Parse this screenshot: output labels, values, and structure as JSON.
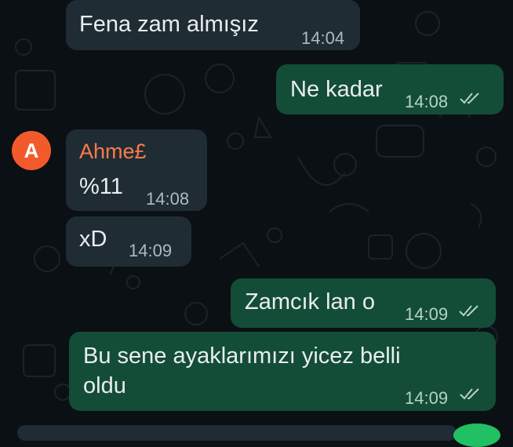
{
  "chat": {
    "messages": [
      {
        "direction": "incoming",
        "text": "Fena zam almışız",
        "time": "14:04"
      },
      {
        "direction": "outgoing",
        "text": "Ne kadar",
        "time": "14:08",
        "status": "read"
      },
      {
        "direction": "incoming",
        "sender": "Ahme£",
        "avatar_initial": "A",
        "text": "%11",
        "time": "14:08"
      },
      {
        "direction": "incoming",
        "text": "xD",
        "time": "14:09"
      },
      {
        "direction": "outgoing",
        "text": "Zamcık lan o",
        "time": "14:09",
        "status": "read"
      },
      {
        "direction": "outgoing",
        "text_line1": "Bu sene ayaklarımızı yicez belli",
        "text_line2": "oldu",
        "time": "14:09",
        "status": "read"
      }
    ]
  },
  "colors": {
    "background": "#0b1014",
    "incoming_bubble": "#1f2c33",
    "outgoing_bubble": "#134d37",
    "sender_name": "#ff7a4d",
    "avatar": "#f35a2b"
  },
  "icons": [
    "double-check-icon",
    "avatar-icon"
  ]
}
